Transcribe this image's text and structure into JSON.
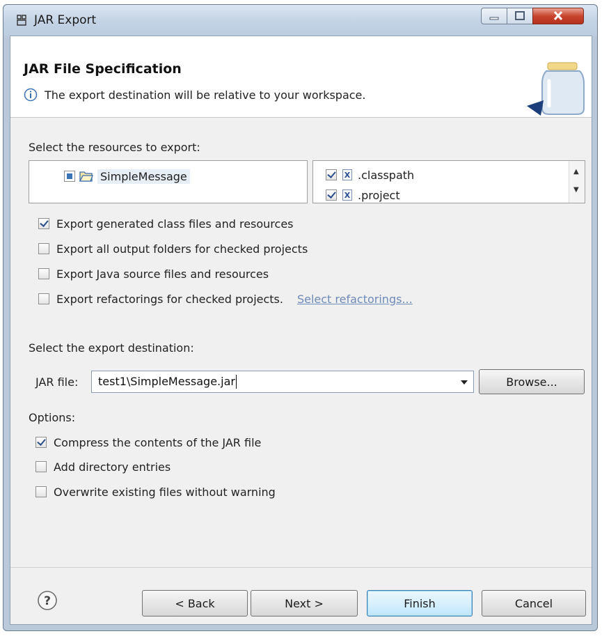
{
  "window": {
    "title": "JAR Export"
  },
  "header": {
    "title": "JAR File Specification",
    "message": "The export destination will be relative to your workspace."
  },
  "resources": {
    "label": "Select the resources to export:",
    "tree_item": "SimpleMessage",
    "files": [
      {
        "name": ".classpath",
        "checked": true
      },
      {
        "name": ".project",
        "checked": true
      }
    ]
  },
  "export_options": [
    {
      "label": "Export generated class files and resources",
      "checked": true
    },
    {
      "label": "Export all output folders for checked projects",
      "checked": false
    },
    {
      "label": "Export Java source files and resources",
      "checked": false
    },
    {
      "label": "Export refactorings for checked projects.",
      "checked": false
    }
  ],
  "refactorings_link": "Select refactorings...",
  "destination": {
    "label": "Select the export destination:",
    "jar_label": "JAR file:",
    "jar_value": "test1\\SimpleMessage.jar",
    "browse_label": "Browse..."
  },
  "options": {
    "label": "Options:",
    "items": [
      {
        "label": "Compress the contents of the JAR file",
        "checked": true
      },
      {
        "label": "Add directory entries",
        "checked": false
      },
      {
        "label": "Overwrite existing files without warning",
        "checked": false
      }
    ]
  },
  "buttons": {
    "back": "< Back",
    "next": "Next >",
    "finish": "Finish",
    "cancel": "Cancel"
  },
  "icons": {
    "app": "jar-export-icon",
    "info": "info-icon",
    "banner": "jar-icon",
    "help": "help-icon"
  }
}
